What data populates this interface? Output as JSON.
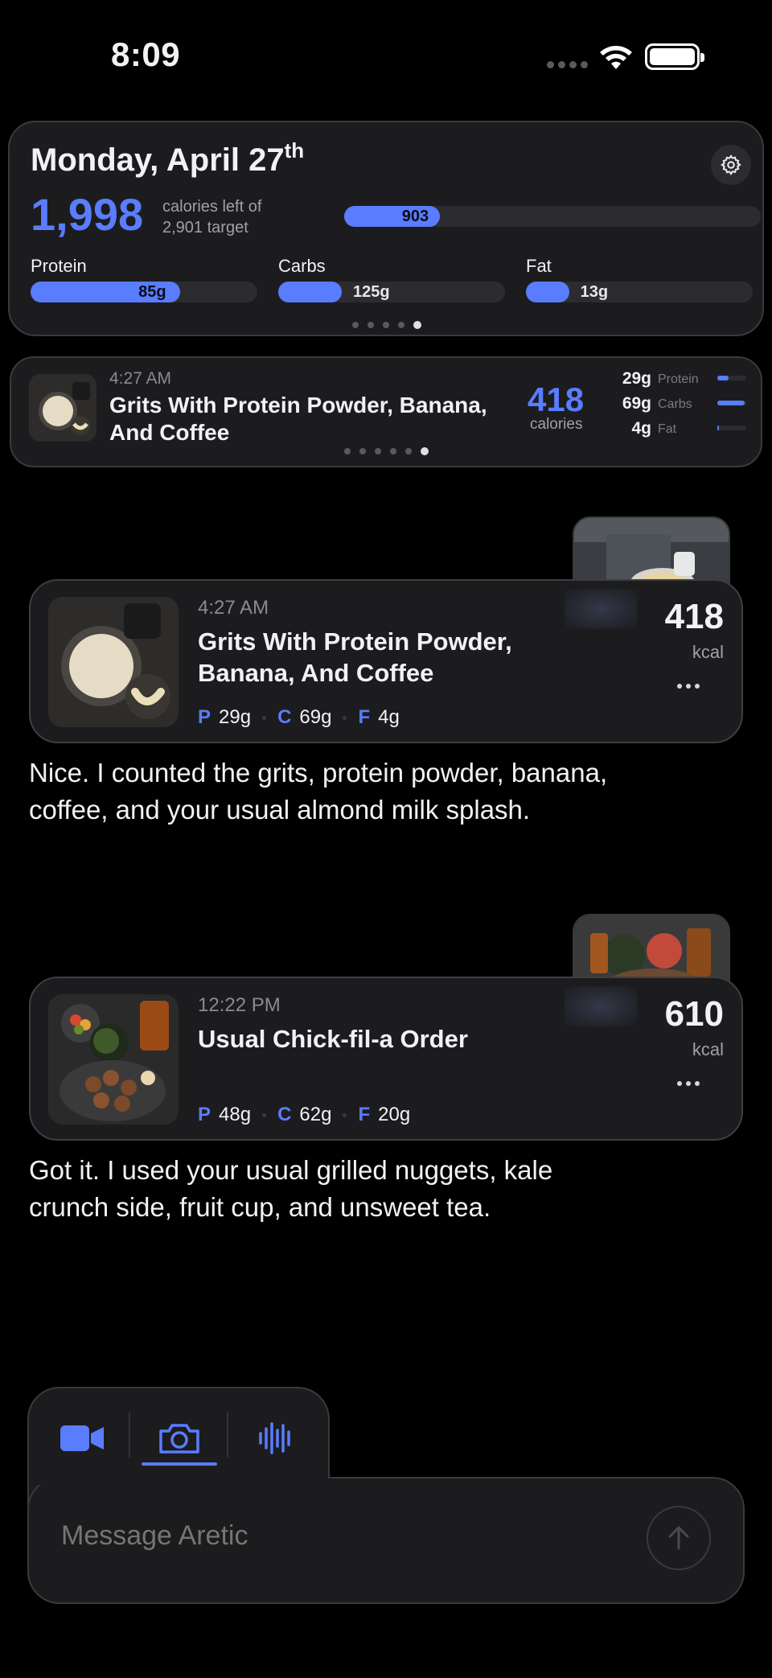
{
  "status_bar": {
    "time": "8:09"
  },
  "summary": {
    "date_main": "Monday, April 27",
    "date_suffix": "th",
    "calories_left": "1,998",
    "caption_line1": "calories left of",
    "caption_line2": "2,901 target",
    "consumed_label": "903",
    "consumed_fraction": 0.23,
    "macros": [
      {
        "name": "Protein",
        "value": "85g",
        "fraction": 0.66
      },
      {
        "name": "Carbs",
        "value": "125g",
        "fraction": 0.28
      },
      {
        "name": "Fat",
        "value": "13g",
        "fraction": 0.19
      }
    ],
    "pager_count": 5,
    "pager_active": 4
  },
  "logged_meal": {
    "time": "4:27 AM",
    "name": "Grits With Protein Powder, Banana, And Coffee",
    "calories": "418",
    "calories_label": "calories",
    "macros": [
      {
        "value": "29g",
        "name": "Protein",
        "fraction": 0.4
      },
      {
        "value": "69g",
        "name": "Carbs",
        "fraction": 0.95
      },
      {
        "value": "4g",
        "name": "Fat",
        "fraction": 0.06
      }
    ],
    "pager_count": 6,
    "pager_active": 5
  },
  "chat": [
    {
      "time": "4:27 AM",
      "name": "Grits With Protein Powder, Banana, And Coffee",
      "kcal": "418",
      "kcal_label": "kcal",
      "protein": "29g",
      "carbs": "69g",
      "fat": "4g",
      "reply": "Nice. I counted the grits, protein powder, banana, coffee, and your usual almond milk splash."
    },
    {
      "time": "12:22 PM",
      "name": "Usual Chick-fil-a Order",
      "kcal": "610",
      "kcal_label": "kcal",
      "protein": "48g",
      "carbs": "62g",
      "fat": "20g",
      "reply": "Got it. I used your usual grilled nuggets, kale crunch side, fruit cup, and unsweet tea."
    }
  ],
  "macro_keys": {
    "p": "P",
    "c": "C",
    "f": "F"
  },
  "composer": {
    "placeholder": "Message Aretic",
    "modes": [
      "video-icon",
      "camera-icon",
      "voice-waveform-icon"
    ],
    "active_mode": "camera-icon"
  },
  "colors": {
    "accent": "#5a7cff",
    "card": "#1c1c1e",
    "border": "#3a3a3e",
    "background": "#000000"
  }
}
